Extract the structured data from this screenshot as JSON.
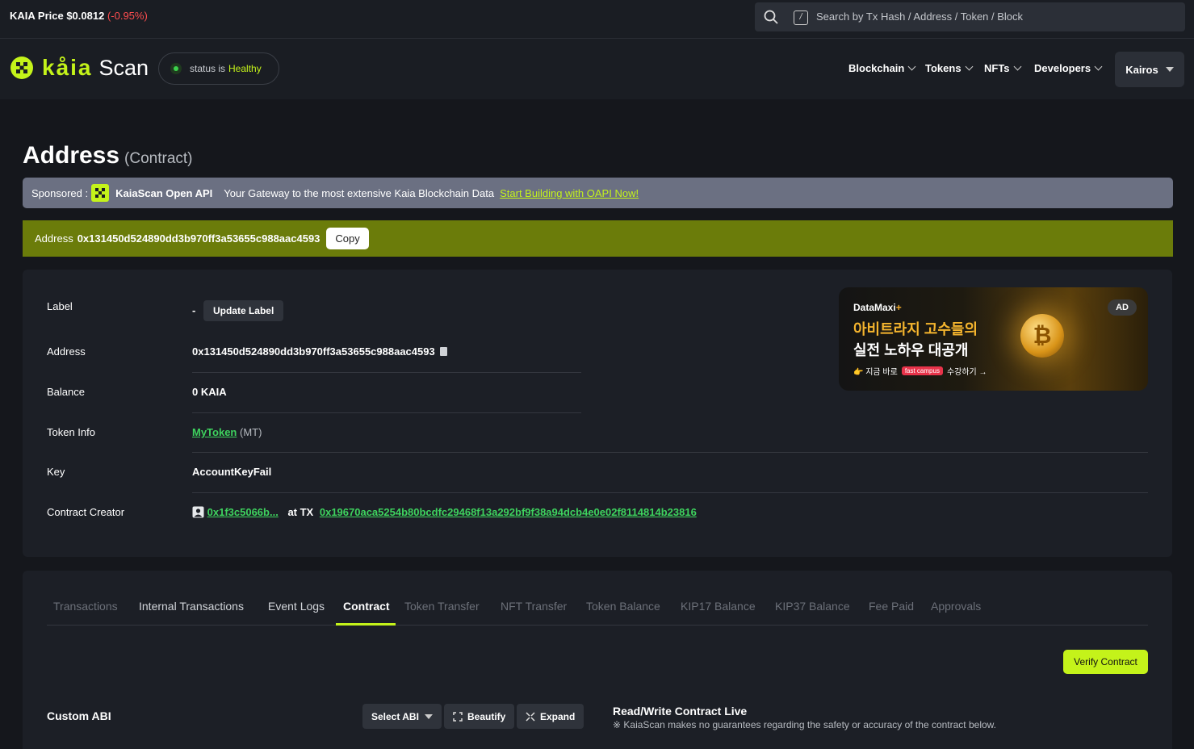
{
  "topbar": {
    "price_label": "KAIA Price $0.0812",
    "price_change": "(-0.95%)",
    "search_placeholder": "Search by Tx Hash / Address / Token / Block",
    "search_shortcut": "/"
  },
  "header": {
    "logo_kaia": "kåia",
    "logo_scan": "Scan",
    "status_prefix": "status is",
    "status_value": "Healthy",
    "nav": [
      "Blockchain",
      "Tokens",
      "NFTs",
      "Developers"
    ],
    "network": "Kairos"
  },
  "page": {
    "title": "Address",
    "subtitle": "(Contract)"
  },
  "sponsor": {
    "prefix": "Sponsored :",
    "name": "KaiaScan Open API",
    "tagline": "Your Gateway to the most extensive Kaia Blockchain Data",
    "link": "Start Building with OAPI Now!"
  },
  "address_bar": {
    "label": "Address",
    "hash": "0x131450d524890dd3b970ff3a53655c988aac4593",
    "copy": "Copy"
  },
  "overview": {
    "label_key": "Label",
    "label_value": "-",
    "update_label": "Update Label",
    "address_key": "Address",
    "address_value": "0x131450d524890dd3b970ff3a53655c988aac4593",
    "balance_key": "Balance",
    "balance_value": "0 KAIA",
    "token_key": "Token Info",
    "token_name": "MyToken",
    "token_symbol": "(MT)",
    "key_key": "Key",
    "key_value": "AccountKeyFail",
    "creator_key": "Contract Creator",
    "creator_addr": "0x1f3c5066b...",
    "creator_at": "at TX",
    "creator_tx": "0x19670aca5254b80bcdfc29468f13a292bf9f38a94dcb4e0e02f8114814b23816"
  },
  "ad": {
    "brand": "DataMaxi",
    "brand_plus": "+",
    "line1": "아비트라지 고수들의",
    "line2": "실전 노하우 대공개",
    "cta_prefix": "👉 지금 바로",
    "cta_partner": "fast campus",
    "cta_suffix": "수강하기 →",
    "tag": "AD"
  },
  "tabs": {
    "items": [
      "Transactions",
      "Internal Transactions",
      "Event Logs",
      "Contract",
      "Token Transfer",
      "NFT Transfer",
      "Token Balance",
      "KIP17 Balance",
      "KIP37 Balance",
      "Fee Paid",
      "Approvals"
    ],
    "active": "Contract"
  },
  "contract": {
    "verify": "Verify Contract",
    "custom_abi": "Custom ABI",
    "select_abi": "Select ABI",
    "beautify": "Beautify",
    "expand": "Expand",
    "rw_title": "Read/Write Contract Live",
    "rw_note": "※ KaiaScan makes no guarantees regarding the safety or accuracy of the contract below."
  },
  "colors": {
    "accent": "#c4f31a",
    "link_green": "#3ed35e",
    "price_down": "#ff4d4f",
    "address_bar_bg": "#6b7c0a"
  }
}
